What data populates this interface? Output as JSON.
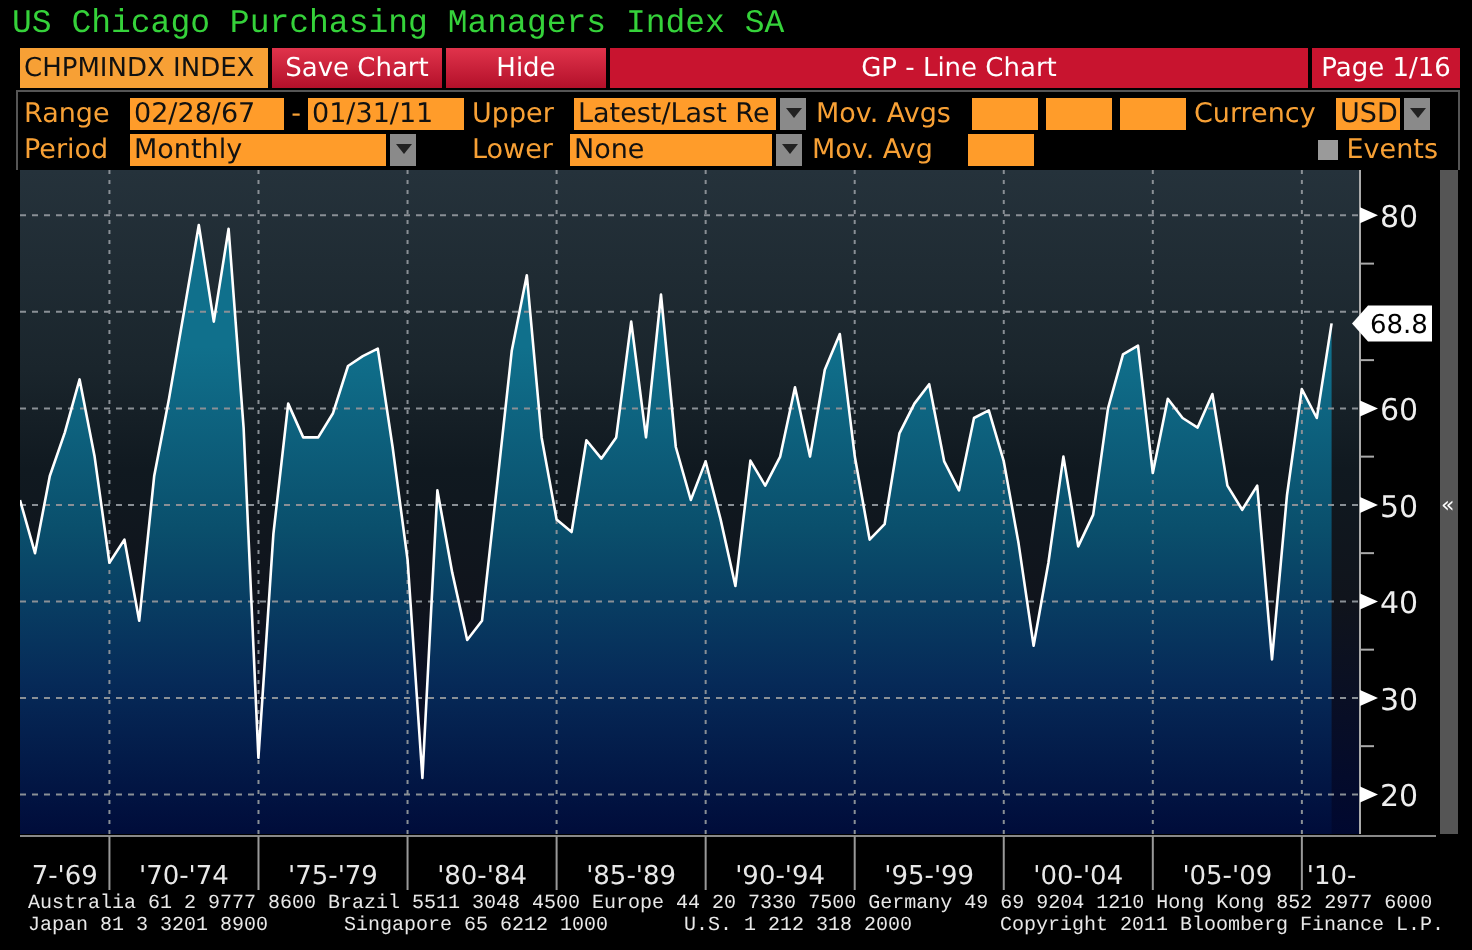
{
  "title": "US Chicago Purchasing Managers Index SA",
  "toolbar": {
    "ticker": "CHPMINDX INDEX",
    "buttons": [
      "Save Chart",
      "Hide"
    ],
    "function_title": "GP - Line Chart",
    "page": "Page 1/16"
  },
  "settings": {
    "range_label": "Range",
    "start_date": "02/28/67",
    "separator": "-",
    "end_date": "01/31/11",
    "upper_label": "Upper",
    "upper_value": "Latest/Last Re",
    "mov_avgs_label": "Mov. Avgs",
    "currency_label": "Currency",
    "currency_value": "USD",
    "period_label": "Period",
    "period_value": "Monthly",
    "lower_label": "Lower",
    "lower_value": "None",
    "mov_avg_label": "Mov. Avg",
    "events": {
      "label": "Events",
      "checked": false
    }
  },
  "chart": {
    "chart_data": {
      "type": "area",
      "grid": true,
      "ylim": [
        15.9,
        84.7
      ],
      "yticks": [
        20,
        30,
        40,
        50,
        60,
        80
      ],
      "categories": [
        null,
        null,
        null,
        "7-'69",
        null,
        null,
        null,
        null,
        null,
        null,
        null,
        "'70-'74",
        null,
        null,
        null,
        null,
        null,
        null,
        null,
        null,
        null,
        "'75-'79",
        null,
        null,
        null,
        null,
        null,
        null,
        null,
        null,
        null,
        "'80-'84",
        null,
        null,
        null,
        null,
        null,
        null,
        null,
        null,
        null,
        "'85-'89",
        null,
        null,
        null,
        null,
        null,
        null,
        null,
        null,
        null,
        "'90-'94",
        null,
        null,
        null,
        null,
        null,
        null,
        null,
        null,
        null,
        "'95-'99",
        null,
        null,
        null,
        null,
        null,
        null,
        null,
        null,
        null,
        "'00-'04",
        null,
        null,
        null,
        null,
        null,
        null,
        null,
        null,
        null,
        "'05-'09",
        null,
        null,
        null,
        null,
        null,
        null,
        "'10-"
      ],
      "series": [
        {
          "color": "#ffffff",
          "values": [
            50.5,
            45,
            53,
            57.5,
            63,
            55,
            44,
            46.4,
            38,
            53,
            61,
            70,
            79,
            69,
            78.6,
            58,
            23.8,
            47,
            60.5,
            57,
            57,
            59.5,
            64.4,
            65.4,
            66.2,
            56,
            44.3,
            21.7,
            51.5,
            43,
            36,
            38,
            52,
            66,
            73.8,
            57,
            48.5,
            47.2,
            56.7,
            54.8,
            57,
            69,
            57,
            71.8,
            56,
            50.5,
            54.5,
            48.5,
            41.6,
            54.6,
            52,
            55,
            62.2,
            55,
            64,
            67.7,
            55,
            46.4,
            48,
            57.4,
            60.5,
            62.5,
            54.5,
            51.5,
            59,
            59.8,
            54.5,
            46,
            35.4,
            44,
            55,
            45.7,
            49,
            60,
            65.6,
            66.5,
            53.3,
            61,
            59,
            58,
            61.5,
            52,
            49.5,
            52,
            34,
            51,
            62,
            59,
            68.8
          ]
        }
      ],
      "annotations": [
        "68.8"
      ]
    },
    "collapse_handle": "«"
  },
  "footer": {
    "line_1": "Australia 61 2 9777 8600 Brazil 5511 3048 4500 Europe 44 20 7330 7500 Germany 49 69 9204 1210 Hong Kong 852 2977 6000",
    "line_2": [
      "Japan 81 3 3201 8900",
      "Singapore 65 6212 1000",
      "U.S. 1 212 318 2000",
      "Copyright 2011 Bloomberg Finance L.P."
    ]
  }
}
